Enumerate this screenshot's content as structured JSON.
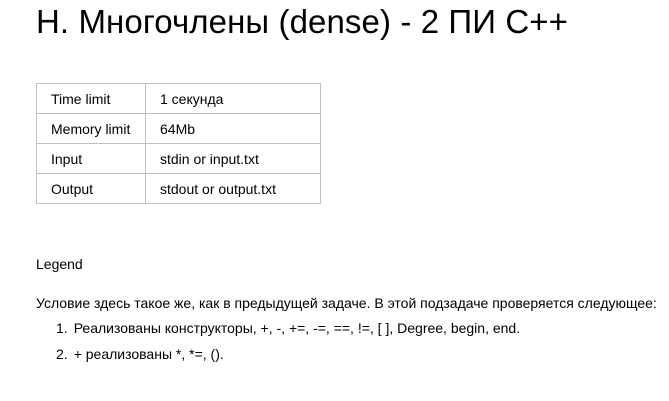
{
  "problem": {
    "title": "H. Многочлены (dense) - 2 ПИ C++"
  },
  "limits": {
    "rows": [
      {
        "key": "Time limit",
        "value": "1 секунда"
      },
      {
        "key": "Memory limit",
        "value": "64Mb"
      },
      {
        "key": "Input",
        "value": "stdin or input.txt"
      },
      {
        "key": "Output",
        "value": "stdout or output.txt"
      }
    ]
  },
  "legend": {
    "label": "Legend",
    "statement": "Условие здесь такое же, как в предыдущей задаче. В этой подзадаче проверяется следующее:",
    "items": [
      {
        "num": "1.",
        "text": "Реализованы конструкторы, +, -, +=, -=, ==, !=, [ ], Degree, begin, end."
      },
      {
        "num": "2.",
        "text": "+ реализованы *, *=, ()."
      }
    ]
  }
}
